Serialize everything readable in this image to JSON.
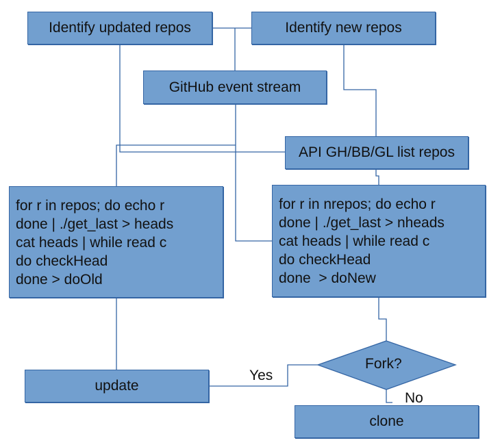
{
  "diagram": {
    "colors": {
      "fill": "#729fcf",
      "stroke": "#3465a4",
      "text": "#111111"
    },
    "nodes": {
      "identify_updated": "Identify updated repos",
      "identify_new": "Identify new repos",
      "github_stream": "GitHub event stream",
      "api_list": "API GH/BB/GL list repos",
      "old_code": [
        "for r in repos; do echo r",
        "done | ./get_last > heads",
        "cat heads | while read c",
        "do checkHead",
        "done > doOld"
      ],
      "new_code": [
        "for r in nrepos; do echo r",
        "done | ./get_last > nheads",
        "cat heads | while read c",
        "do checkHead",
        "done  > doNew"
      ],
      "update": "update",
      "fork_decision": "Fork?",
      "clone": "clone"
    },
    "edge_labels": {
      "yes": "Yes",
      "no": "No"
    },
    "edges": [
      {
        "from": "identify_updated",
        "to": "identify_new"
      },
      {
        "from": "identify_updated",
        "to": "github_stream"
      },
      {
        "from": "identify_updated",
        "to": "api_list"
      },
      {
        "from": "github_stream",
        "to": "new_code"
      },
      {
        "from": "github_stream",
        "to": "old_code"
      },
      {
        "from": "identify_new",
        "to": "api_list"
      },
      {
        "from": "api_list",
        "to": "new_code"
      },
      {
        "from": "new_code",
        "to": "fork_decision"
      },
      {
        "from": "old_code",
        "to": "update"
      },
      {
        "from": "fork_decision",
        "to": "update",
        "label": "Yes"
      },
      {
        "from": "fork_decision",
        "to": "clone",
        "label": "No"
      }
    ]
  }
}
